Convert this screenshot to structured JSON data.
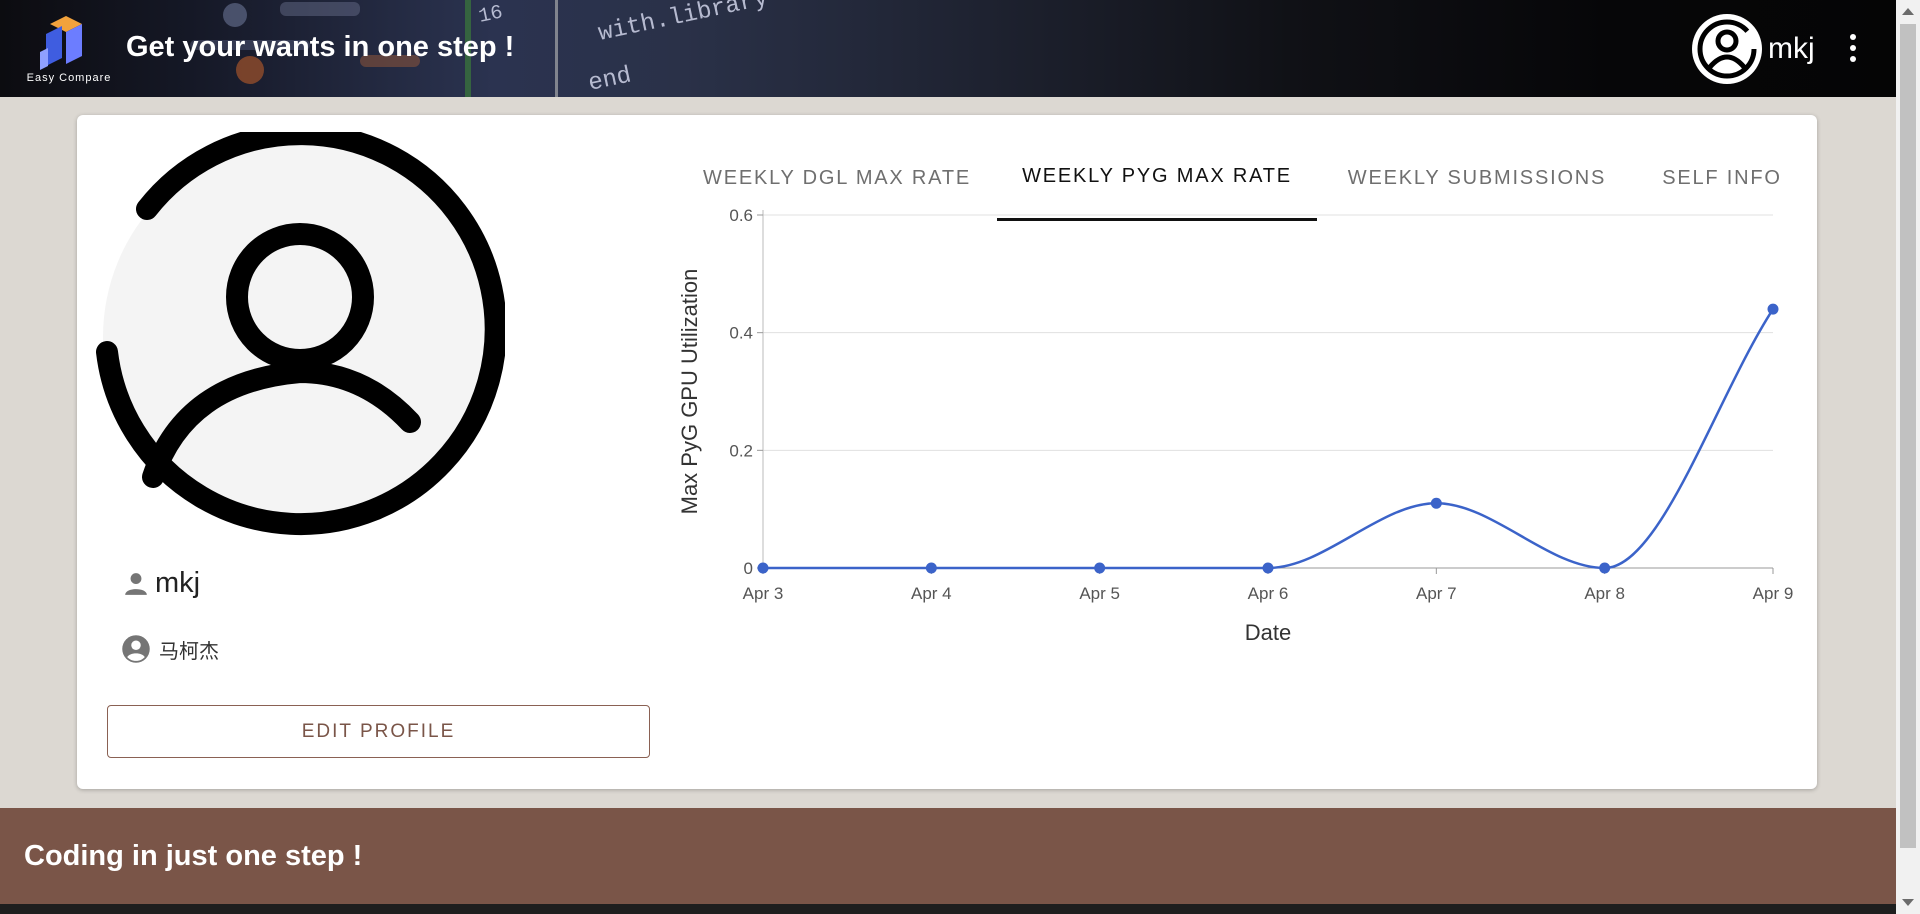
{
  "header": {
    "logo_text": "Easy Compare",
    "title": "Get your wants in one step !",
    "username": "mkj"
  },
  "profile": {
    "username": "mkj",
    "real_name": "马柯杰",
    "edit_button": "EDIT PROFILE"
  },
  "tabs": [
    {
      "label": "WEEKLY DGL MAX RATE"
    },
    {
      "label": "WEEKLY PYG MAX RATE"
    },
    {
      "label": "WEEKLY SUBMISSIONS"
    },
    {
      "label": "SELF INFO"
    }
  ],
  "active_tab": 1,
  "chart_data": {
    "type": "line",
    "x": [
      "Apr 3",
      "Apr 4",
      "Apr 5",
      "Apr 6",
      "Apr 7",
      "Apr 8",
      "Apr 9"
    ],
    "values": [
      0,
      0,
      0,
      0,
      0.11,
      0,
      0.44
    ],
    "xlabel": "Date",
    "ylabel": "Max PyG GPU Utilization",
    "ylim": [
      0,
      0.6
    ],
    "yticks": [
      "0",
      "0.2",
      "0.4",
      "0.6"
    ],
    "grid": true,
    "color": "#3b63c9",
    "smooth": true
  },
  "footer": {
    "text": "Coding in just one step !"
  },
  "colors": {
    "accent": "#7a5548",
    "line": "#3b63c9"
  }
}
